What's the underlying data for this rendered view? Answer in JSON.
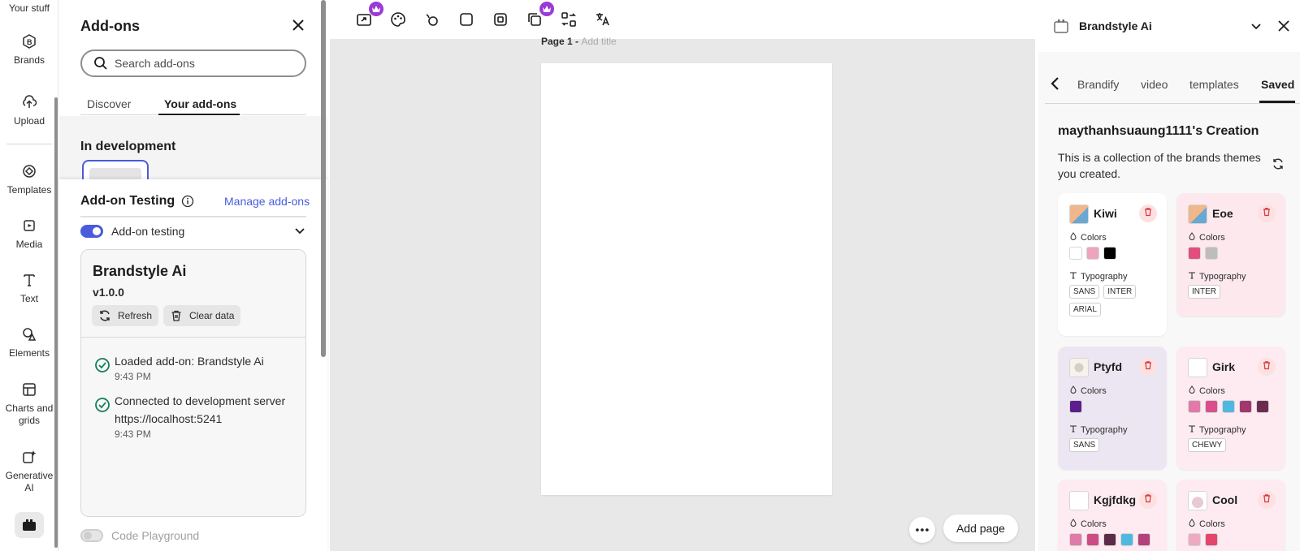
{
  "rail": {
    "top_label": "Your stuff",
    "items": [
      {
        "label": "Brands"
      },
      {
        "label": "Upload"
      },
      {
        "label": "Templates"
      },
      {
        "label": "Media"
      },
      {
        "label": "Text"
      },
      {
        "label": "Elements"
      },
      {
        "label": "Charts and grids"
      },
      {
        "label": "Generative AI"
      }
    ]
  },
  "addons": {
    "title": "Add-ons",
    "search_placeholder": "Search add-ons",
    "tabs": [
      {
        "label": "Discover"
      },
      {
        "label": "Your add-ons"
      }
    ],
    "in_dev_title": "In development",
    "testing_title": "Add-on Testing",
    "manage_label": "Manage add-ons",
    "testing_toggle_label": "Add-on testing",
    "card": {
      "name": "Brandstyle Ai",
      "version": "v1.0.0",
      "refresh_label": "Refresh",
      "clear_label": "Clear data",
      "logs": [
        {
          "text": "Loaded add-on: Brandstyle Ai",
          "time": "9:43 PM"
        },
        {
          "text": "Connected to development server https://localhost:5241",
          "time": "9:43 PM"
        }
      ]
    },
    "playground_label": "Code Playground"
  },
  "canvas": {
    "page_label": "Page 1 - ",
    "page_title_placeholder": "Add title",
    "add_page_label": "Add page"
  },
  "right_panel": {
    "title": "Brandstyle Ai",
    "tabs": [
      {
        "label": "Brandify"
      },
      {
        "label": "video"
      },
      {
        "label": "templates"
      },
      {
        "label": "Saved"
      }
    ],
    "creation_title": "maythanhsuaung1111's Creation",
    "creation_desc": "This is a collection of the brands themes you created.",
    "colors_label": "Colors",
    "typography_label": "Typography",
    "brands": [
      {
        "name": "Kiwi",
        "bg": "#ffffff",
        "colors": [
          "#ffffff",
          "#eea4bf",
          "#000000"
        ],
        "fonts": [
          "SANS",
          "INTER",
          "ARIAL"
        ]
      },
      {
        "name": "Eoe",
        "bg": "#fde8ee",
        "colors": [
          "#e24f7c",
          "#bdbdbd"
        ],
        "fonts": [
          "INTER"
        ]
      },
      {
        "name": "Ptyfd",
        "bg": "#ece6f2",
        "colors": [
          "#5b1f8e"
        ],
        "fonts": [
          "SANS"
        ]
      },
      {
        "name": "Girk",
        "bg": "#fdebf1",
        "colors": [
          "#e17aa8",
          "#d94f8a",
          "#4fb8e0",
          "#a3366f",
          "#6b2d4f"
        ],
        "fonts": [
          "CHEWY"
        ]
      },
      {
        "name": "Kgjfdkg",
        "bg": "#fdebf1",
        "colors": [
          "#e07aa8",
          "#cc4d84",
          "#5c2b46",
          "#4fb8e0",
          "#b5417b"
        ],
        "fonts": []
      },
      {
        "name": "Cool",
        "bg": "#fdebf1",
        "colors": [
          "#eeaac2",
          "#e4456d"
        ],
        "fonts": []
      }
    ]
  }
}
